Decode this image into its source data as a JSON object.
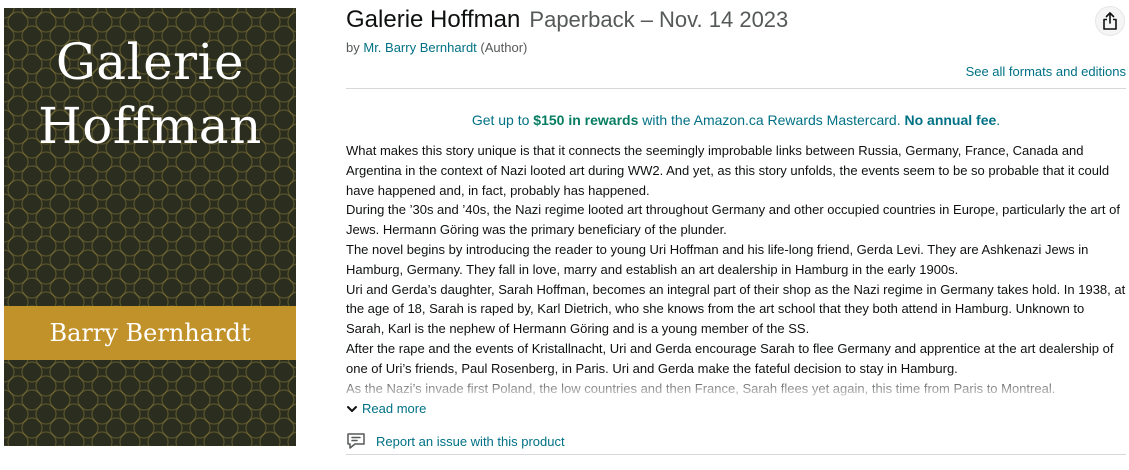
{
  "cover": {
    "title_line1": "Galerie",
    "title_line2": "Hoffman",
    "author": "Barry Bernhardt",
    "colors": {
      "background": "#2b2e1e",
      "pattern": "#a69446",
      "author_band": "#c1922a"
    }
  },
  "product": {
    "title": "Galerie Hoffman",
    "format": "Paperback – Nov. 14 2023",
    "byline_prefix": "by",
    "author_name": "Mr. Barry Bernhardt",
    "author_role": "(Author)",
    "share_icon": "share-icon",
    "see_formats": "See all formats and editions"
  },
  "promo": {
    "prefix": "Get up to",
    "amount": "$150 in rewards",
    "middle": "with the Amazon.ca Rewards Mastercard.",
    "fee": "No annual fee",
    "suffix": "."
  },
  "description": {
    "paragraphs": [
      "What makes this story unique is that it connects the seemingly improbable links between Russia, Germany, France, Canada and Argentina in the context of Nazi looted art during WW2. And yet, as this story unfolds, the events seem to be so probable that it could have happened and, in fact, probably has happened.",
      "During the ’30s and ’40s, the Nazi regime looted art throughout Germany and other occupied countries in Europe, particularly the art of Jews. Hermann Göring was the primary beneficiary of the plunder.",
      "The novel begins by introducing the reader to young Uri Hoffman and his life-long friend, Gerda Levi. They are Ashkenazi Jews in Hamburg, Germany. They fall in love, marry and establish an art dealership in Hamburg in the early 1900s.",
      "Uri and Gerda’s daughter, Sarah Hoffman, becomes an integral part of their shop as the Nazi regime in Germany takes hold. In 1938, at the age of 18, Sarah is raped by, Karl Dietrich, who she knows from the art school that they both attend in Hamburg. Unknown to Sarah, Karl is the nephew of Hermann Göring and is a young member of the SS.",
      "After the rape and the events of Kristallnacht, Uri and Gerda encourage Sarah to flee Germany and apprentice at the art dealership of one of Uri’s friends, Paul Rosenberg, in Paris. Uri and Gerda make the fateful decision to stay in Hamburg.",
      "As the Nazi’s invade first Poland, the low countries and then France, Sarah flees yet again, this time from Paris to Montreal."
    ],
    "read_more": "Read more",
    "read_more_icon": "chevron-down-icon"
  },
  "report": {
    "label": "Report an issue with this product",
    "icon": "comment-flag-icon"
  }
}
